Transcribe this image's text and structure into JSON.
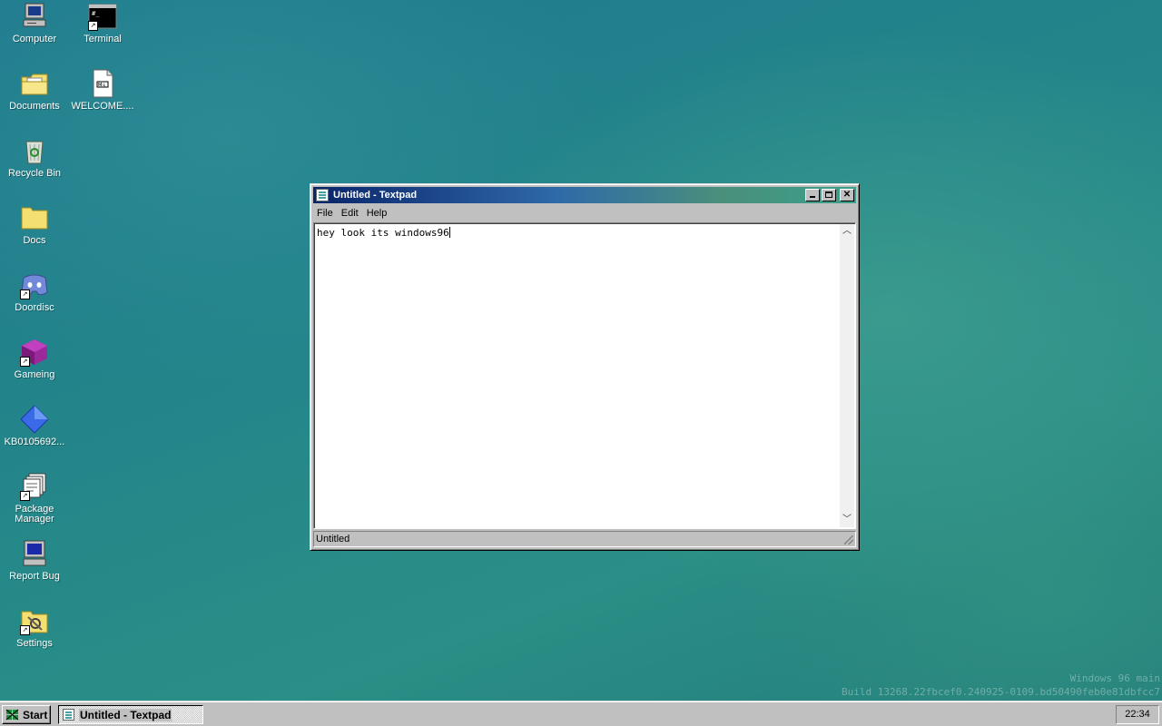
{
  "desktop": {
    "icons": [
      {
        "label": "Computer",
        "icon": "computer-icon"
      },
      {
        "label": "Terminal",
        "icon": "terminal-icon"
      },
      {
        "label": "Documents",
        "icon": "documents-folder-icon"
      },
      {
        "label": "WELCOME....",
        "icon": "text-file-icon"
      },
      {
        "label": "Recycle Bin",
        "icon": "recycle-bin-icon"
      },
      {
        "label": "Docs",
        "icon": "folder-icon"
      },
      {
        "label": "Doordisc",
        "icon": "chat-app-icon"
      },
      {
        "label": "Gameing",
        "icon": "game-cube-icon"
      },
      {
        "label": "KB0105692...",
        "icon": "blue-diamond-icon"
      },
      {
        "label": "Package Manager",
        "icon": "package-manager-icon"
      },
      {
        "label": "Report Bug",
        "icon": "report-bug-icon"
      },
      {
        "label": "Settings",
        "icon": "settings-icon"
      }
    ]
  },
  "window": {
    "title": "Untitled - Textpad",
    "menu": [
      "File",
      "Edit",
      "Help"
    ],
    "content": "hey look its windows96",
    "status": "Untitled"
  },
  "watermark": {
    "line1": "Windows 96 main",
    "line2": "Build 13268.22fbcef0.240925-0109.bd50490feb0e81dbfcc7"
  },
  "taskbar": {
    "start_label": "Start",
    "task_label": "Untitled - Textpad",
    "clock": "22:34"
  }
}
